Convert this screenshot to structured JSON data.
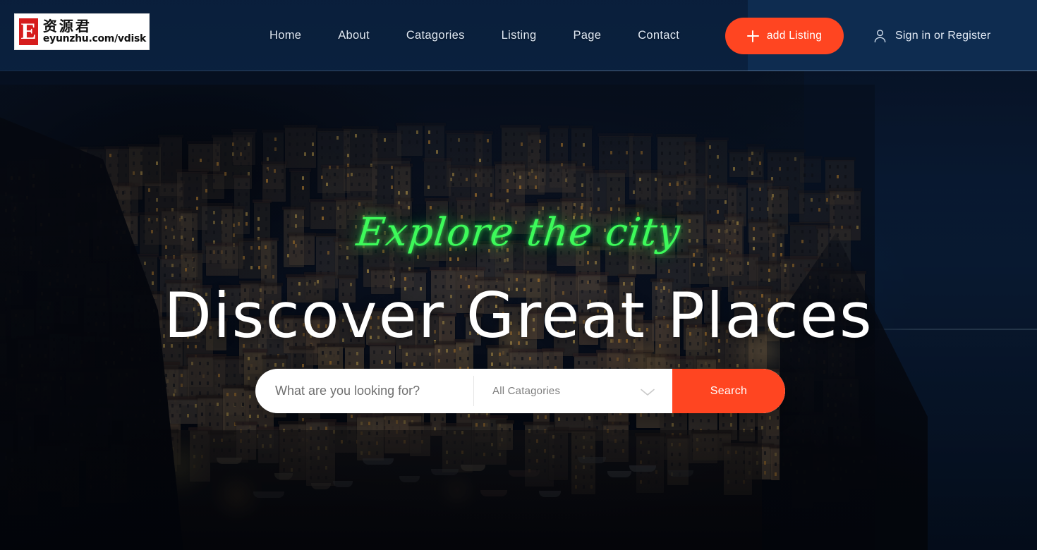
{
  "brand": {
    "logo_letter": "E",
    "logo_cn": "资源君",
    "logo_url": "eyunzhu.com/vdisk"
  },
  "header": {
    "nav": [
      {
        "label": "Home"
      },
      {
        "label": "About"
      },
      {
        "label": "Catagories"
      },
      {
        "label": "Listing"
      },
      {
        "label": "Page"
      },
      {
        "label": "Contact"
      }
    ],
    "add_listing_label": "add Listing",
    "plus_icon": "plus-icon",
    "account_icon": "user-icon",
    "account_label": "Sign in or Register"
  },
  "hero": {
    "script_title": "Explore the city",
    "main_title": "Discover Great Places",
    "search": {
      "input_placeholder": "What are you looking for?",
      "input_value": "",
      "category_selected": "All Catagories",
      "category_chevron_icon": "chevron-down-icon",
      "button_label": "Search"
    }
  },
  "colors": {
    "accent": "#ff4521",
    "header_bg": "#0e2c50",
    "neon_green": "#3dfa5a",
    "hero_text": "#ffffff"
  }
}
